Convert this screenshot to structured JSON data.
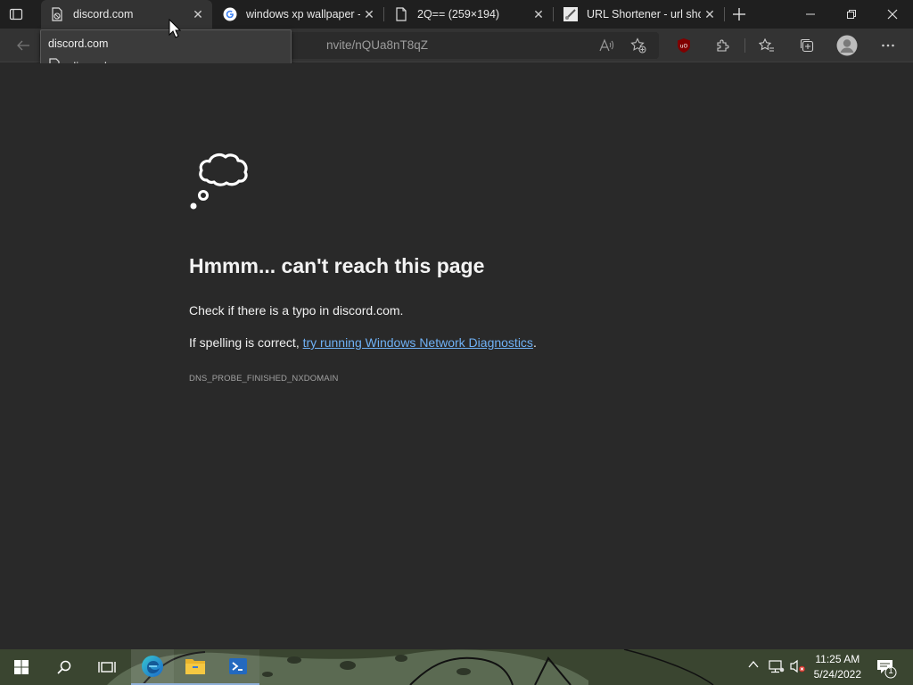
{
  "tabs": [
    {
      "title": "discord.com",
      "icon": "page-error-icon",
      "active": true
    },
    {
      "title": "windows xp wallpaper -",
      "icon": "google-icon"
    },
    {
      "title": "2Q== (259×194)",
      "icon": "page-icon"
    },
    {
      "title": "URL Shortener - url sho",
      "icon": "url-shortener-icon"
    }
  ],
  "tooltip": {
    "title": "discord.com",
    "url": "discord.com"
  },
  "address_bar": {
    "url_visible": "nvite/nQUa8nT8qZ"
  },
  "error_page": {
    "heading": "Hmmm... can't reach this page",
    "line1": "Check if there is a typo in discord.com.",
    "line2_prefix": "If spelling is correct, ",
    "line2_link": "try running Windows Network Diagnostics",
    "line2_suffix": ".",
    "error_code": "DNS_PROBE_FINISHED_NXDOMAIN"
  },
  "taskbar": {
    "time": "11:25 AM",
    "date": "5/24/2022",
    "notification_count": "1"
  },
  "colors": {
    "link": "#6fb1f5",
    "background": "#292929",
    "ublock_red": "#800000"
  }
}
